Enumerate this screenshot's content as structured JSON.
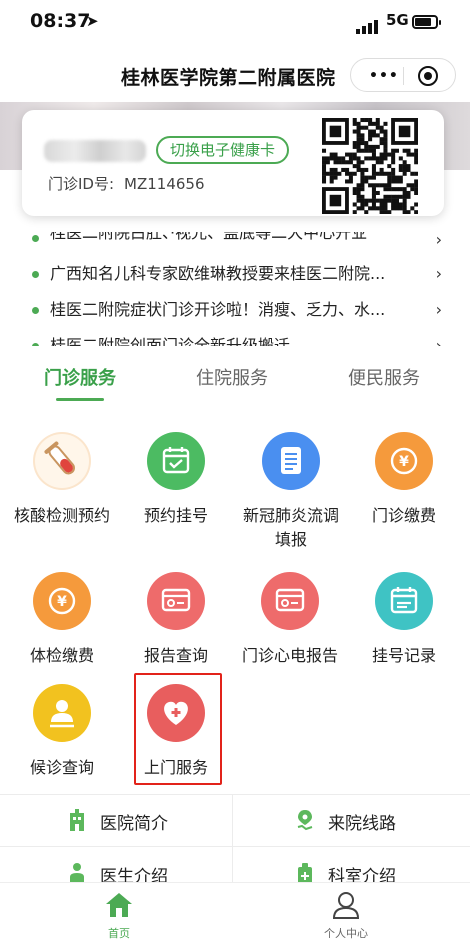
{
  "status_bar": {
    "time": "08:37",
    "location_icon": "location-arrow-icon",
    "network": "5G"
  },
  "navbar": {
    "title": "桂林医学院第二附属医院",
    "more_icon": "more-dots-icon",
    "close_icon": "target-circle-icon"
  },
  "card": {
    "switch_label": "切换电子健康卡",
    "id_label": "门诊ID号:",
    "id_value": "MZ114656"
  },
  "news": [
    {
      "text": "桂医二附院白肚、·视光、盖底等二大中心开业"
    },
    {
      "text": "广西知名儿科专家欧维琳教授要来桂医二附院..."
    },
    {
      "text": "桂医二附院症状门诊开诊啦！消瘦、乏力、水..."
    },
    {
      "text": "桂医二附院创面门诊全新升级搬迁"
    }
  ],
  "tabs": [
    {
      "label": "门诊服务",
      "active": true
    },
    {
      "label": "住院服务",
      "active": false
    },
    {
      "label": "便民服务",
      "active": false
    }
  ],
  "services": [
    {
      "label": "核酸检测预约",
      "icon": "test-tube-icon",
      "color": "#fbe5cc"
    },
    {
      "label": "预约挂号",
      "icon": "calendar-check-icon",
      "color": "#4cbb62"
    },
    {
      "label": "新冠肺炎流调填报",
      "icon": "document-icon",
      "color": "#4a8ff0"
    },
    {
      "label": "门诊缴费",
      "icon": "yen-coin-icon",
      "color": "#f59a3c"
    },
    {
      "label": "体检缴费",
      "icon": "yen-coin-icon",
      "color": "#f59a3c"
    },
    {
      "label": "报告查询",
      "icon": "report-screen-icon",
      "color": "#ee6b6b"
    },
    {
      "label": "门诊心电报告",
      "icon": "report-screen-icon",
      "color": "#ee6b6b"
    },
    {
      "label": "挂号记录",
      "icon": "calendar-list-icon",
      "color": "#3fc3c4"
    },
    {
      "label": "候诊查询",
      "icon": "person-queue-icon",
      "color": "#f2c21f"
    },
    {
      "label": "上门服务",
      "icon": "heart-plus-icon",
      "color": "#e85e5e"
    }
  ],
  "bottom_links": [
    {
      "label": "医院简介",
      "icon": "hospital-building-icon"
    },
    {
      "label": "来院线路",
      "icon": "map-route-icon"
    },
    {
      "label": "医生介绍",
      "icon": "doctor-icon"
    },
    {
      "label": "科室介绍",
      "icon": "department-icon"
    }
  ],
  "tabbar": [
    {
      "label": "首页",
      "icon": "home-icon",
      "active": true
    },
    {
      "label": "个人中心",
      "icon": "user-icon",
      "active": false
    }
  ],
  "colors": {
    "accent": "#4caa54",
    "highlight_box": "#e2231a"
  }
}
